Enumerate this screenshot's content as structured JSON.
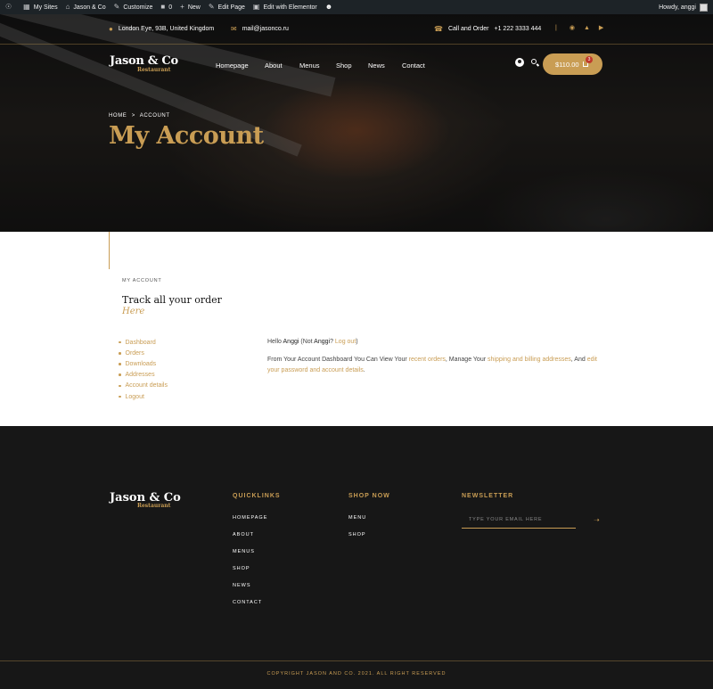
{
  "admin_bar": {
    "items": [
      {
        "label": "",
        "icon": "wordpress-icon"
      },
      {
        "label": "My Sites",
        "icon": "my-sites-icon"
      },
      {
        "label": "Jason & Co",
        "icon": "home-icon"
      },
      {
        "label": "Customize",
        "icon": "brush-icon"
      },
      {
        "label": "0",
        "icon": "comment-icon"
      },
      {
        "label": "New",
        "icon": "plus-icon"
      },
      {
        "label": "Edit Page",
        "icon": "pencil-icon"
      },
      {
        "label": "Edit with Elementor",
        "icon": "elementor-icon"
      },
      {
        "label": "",
        "icon": "smiley-icon"
      }
    ],
    "greeting": "Howdy, anggi"
  },
  "top_info": {
    "address": "London Eye, 93B, United Kingdom",
    "email": "mail@jasonco.ru",
    "call_label": "Call and Order",
    "phone": "+1 222 3333 444",
    "divider": "|",
    "social": [
      "facebook-icon",
      "twitter-icon",
      "youtube-icon"
    ]
  },
  "brand": {
    "name": "Jason & Co",
    "sub": "Restaurant"
  },
  "nav": {
    "items": [
      "Homepage",
      "About",
      "Menus",
      "Shop",
      "News",
      "Contact"
    ],
    "cart_total": "$110.00",
    "cart_count": "3"
  },
  "hero": {
    "breadcrumb": [
      "HOME",
      ">",
      "ACCOUNT"
    ],
    "title": "My Account"
  },
  "account": {
    "eyebrow": "MY ACCOUNT",
    "title": "Track all your order",
    "title_accent": "Here",
    "nav": [
      "Dashboard",
      "Orders",
      "Downloads",
      "Addresses",
      "Account details",
      "Logout"
    ],
    "hello_prefix": "Hello ",
    "user": "Anggi",
    "not_prefix": " (Not ",
    "not_user": "Anggi",
    "not_suffix": "? ",
    "logout": "Log out",
    "close_paren": ")",
    "desc_1": "From Your Account Dashboard You Can View Your ",
    "link_recent_orders": "recent orders",
    "desc_2": ", Manage Your ",
    "link_addresses": "shipping and billing addresses",
    "desc_3": ", And ",
    "link_edit": "edit your password and account details",
    "desc_4": "."
  },
  "footer": {
    "quicklinks_title": "QUICKLINKS",
    "quicklinks": [
      "HOMEPAGE",
      "ABOUT",
      "MENUS",
      "SHOP",
      "NEWS",
      "CONTACT"
    ],
    "shop_title": "SHOP NOW",
    "shop_links": [
      "MENU",
      "SHOP"
    ],
    "newsletter_title": "NEWSLETTER",
    "newsletter_placeholder": "TYPE YOUR EMAIL HERE",
    "copyright": "COPYRIGHT JASON AND CO. 2021. ALL RIGHT RESERVED"
  },
  "colors": {
    "accent": "#c99d54",
    "dark": "#171717",
    "admin": "#1d2327"
  }
}
